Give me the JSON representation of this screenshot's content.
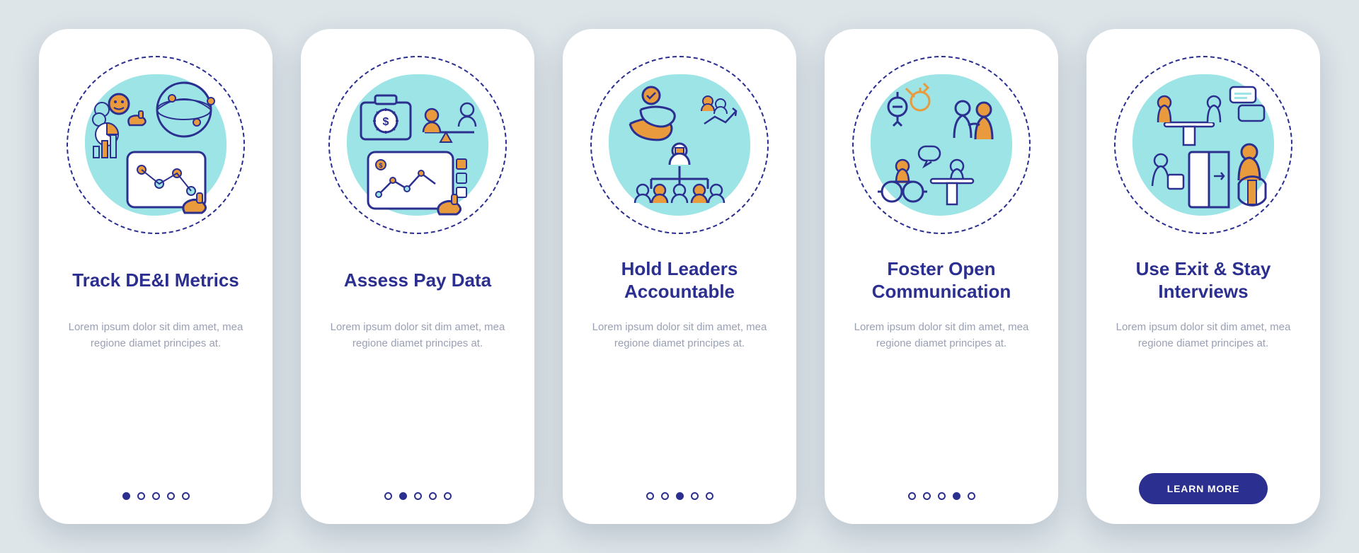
{
  "colors": {
    "background": "#dde5e9",
    "card": "#ffffff",
    "primary": "#2b2f8f",
    "accent": "#e89a3c",
    "accent_light": "#9de4e6",
    "text_muted": "#9aa0b4"
  },
  "slide_count": 5,
  "cards": [
    {
      "title": "Track DE&I Metrics",
      "body": "Lorem ipsum dolor sit dim amet, mea regione diamet principes at.",
      "active_index": 0,
      "icon": "metrics-illustration",
      "has_cta": false
    },
    {
      "title": "Assess Pay Data",
      "body": "Lorem ipsum dolor sit dim amet, mea regione diamet principes at.",
      "active_index": 1,
      "icon": "pay-data-illustration",
      "has_cta": false
    },
    {
      "title": "Hold Leaders Accountable",
      "body": "Lorem ipsum dolor sit dim amet, mea regione diamet principes at.",
      "active_index": 2,
      "icon": "leaders-illustration",
      "has_cta": false
    },
    {
      "title": "Foster Open Communication",
      "body": "Lorem ipsum dolor sit dim amet, mea regione diamet principes at.",
      "active_index": 3,
      "icon": "communication-illustration",
      "has_cta": false
    },
    {
      "title": "Use Exit & Stay Interviews",
      "body": "Lorem ipsum dolor sit dim amet, mea regione diamet principes at.",
      "active_index": 4,
      "icon": "interviews-illustration",
      "has_cta": true,
      "cta_label": "LEARN MORE"
    }
  ]
}
